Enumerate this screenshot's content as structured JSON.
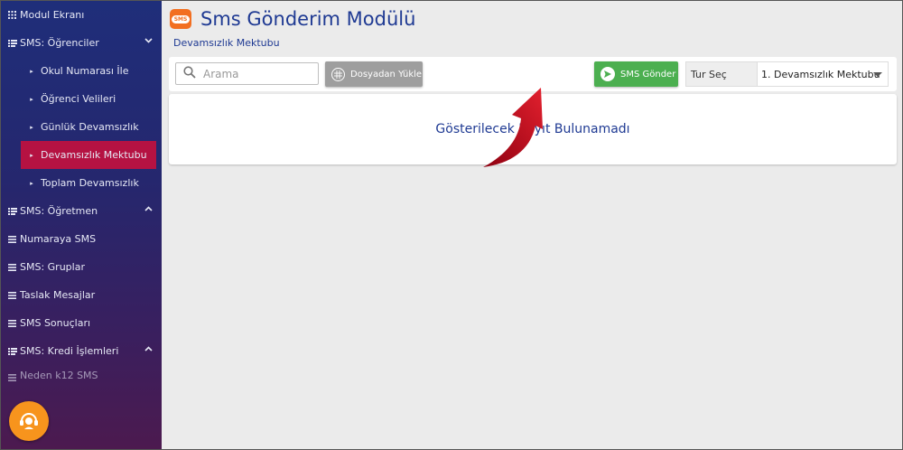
{
  "sidebar": {
    "items": [
      {
        "label": "Modul Ekranı",
        "icon": "grid-icon"
      },
      {
        "label": "SMS: Öğrenciler",
        "icon": "list-icon",
        "chevron": "down"
      },
      {
        "label": "Okul Numarası İle",
        "sub": true
      },
      {
        "label": "Öğrenci Velileri",
        "sub": true
      },
      {
        "label": "Günlük Devamsızlık",
        "sub": true
      },
      {
        "label": "Devamsızlık Mektubu",
        "sub": true,
        "active": true
      },
      {
        "label": "Toplam Devamsızlık",
        "sub": true
      },
      {
        "label": "SMS: Öğretmen",
        "icon": "list-icon",
        "chevron": "up"
      },
      {
        "label": "Numaraya SMS",
        "icon": "menu-icon"
      },
      {
        "label": "SMS: Gruplar",
        "icon": "menu-icon"
      },
      {
        "label": "Taslak Mesajlar",
        "icon": "menu-icon"
      },
      {
        "label": "SMS Sonuçları",
        "icon": "menu-icon"
      },
      {
        "label": "SMS: Kredi İşlemleri",
        "icon": "list-icon",
        "chevron": "up"
      },
      {
        "label": "Neden k12 SMS",
        "icon": "menu-icon"
      }
    ],
    "active_color": "#b51242",
    "support_color": "#f7941d"
  },
  "header": {
    "logo_text": "SMS",
    "title": "Sms Gönderim Modülü",
    "subtitle": "Devamsızlık Mektubu"
  },
  "toolbar": {
    "search_placeholder": "Arama",
    "upload_label": "Dosyadan Yükle",
    "send_label": "SMS Gönder",
    "send_color": "#4caf50",
    "type_label": "Tur Seç",
    "type_selected": "1. Devamsızlık Mektubu"
  },
  "content": {
    "empty_message": "Gösterilecek Kayıt Bulunamadı"
  }
}
